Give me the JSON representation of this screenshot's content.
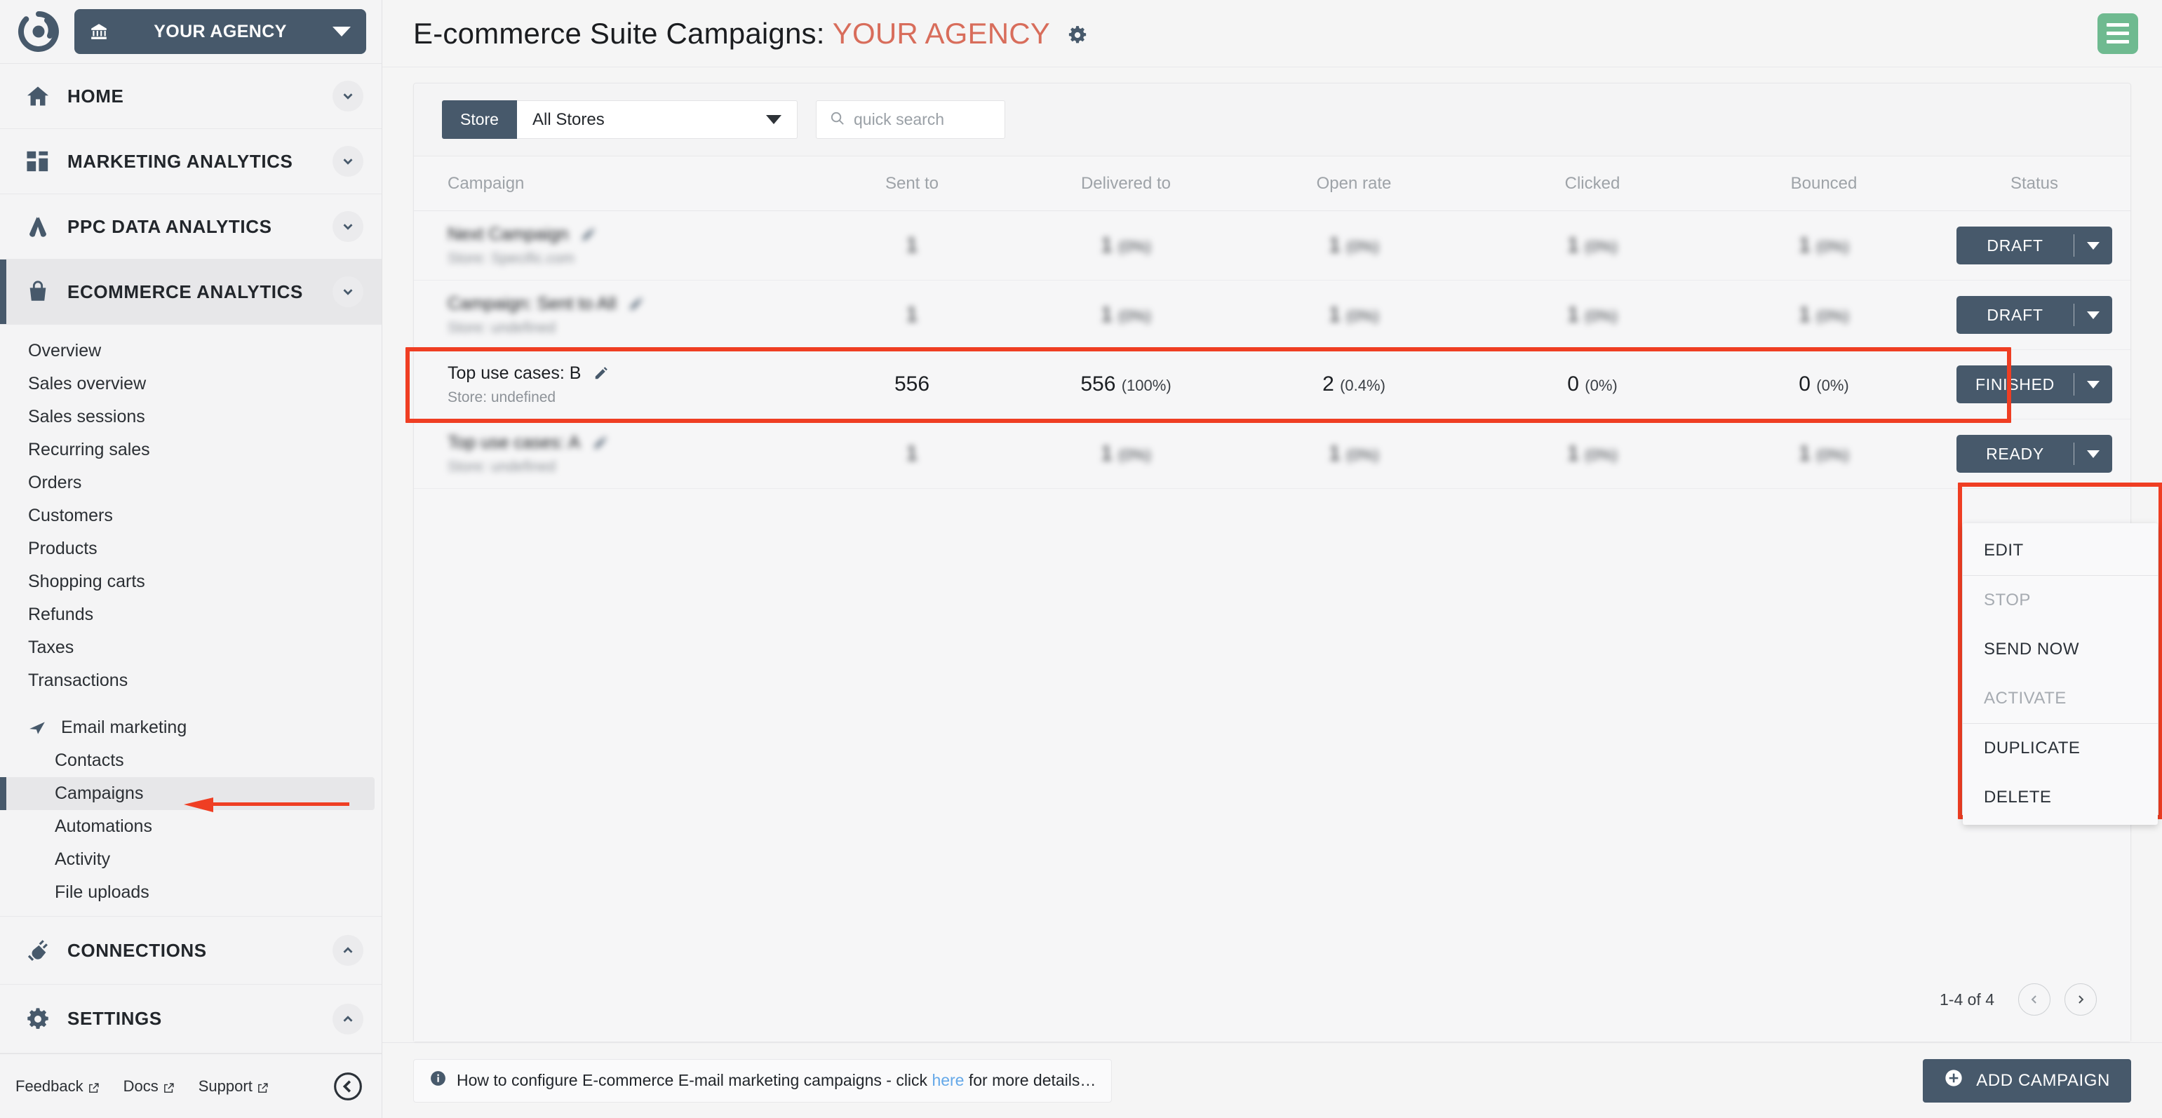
{
  "sidebar": {
    "agency_button": {
      "label": "YOUR AGENCY",
      "icon": "bank-icon"
    },
    "sections": [
      {
        "label": "HOME",
        "icon": "home-icon",
        "chevron": "chevron-down-icon",
        "active": false
      },
      {
        "label": "MARKETING ANALYTICS",
        "icon": "grid-icon",
        "chevron": "chevron-down-icon",
        "active": false
      },
      {
        "label": "PPC DATA ANALYTICS",
        "icon": "ads-icon",
        "chevron": "chevron-down-icon",
        "active": false
      },
      {
        "label": "ECOMMERCE ANALYTICS",
        "icon": "bag-icon",
        "chevron": "chevron-down-icon",
        "active": true
      }
    ],
    "links": [
      {
        "label": "Overview"
      },
      {
        "label": "Sales overview"
      },
      {
        "label": "Sales sessions"
      },
      {
        "label": "Recurring sales"
      },
      {
        "label": "Orders"
      },
      {
        "label": "Customers"
      },
      {
        "label": "Products"
      },
      {
        "label": "Shopping carts"
      },
      {
        "label": "Refunds"
      },
      {
        "label": "Taxes"
      },
      {
        "label": "Transactions"
      }
    ],
    "email_group": {
      "label": "Email marketing",
      "icon": "send-icon"
    },
    "email_links": [
      {
        "label": "Contacts",
        "selected": false
      },
      {
        "label": "Campaigns",
        "selected": true
      },
      {
        "label": "Automations",
        "selected": false
      },
      {
        "label": "Activity",
        "selected": false
      },
      {
        "label": "File uploads",
        "selected": false
      }
    ],
    "bottom_sections": [
      {
        "label": "CONNECTIONS",
        "icon": "plug-icon",
        "chevron": "chevron-up-icon"
      },
      {
        "label": "SETTINGS",
        "icon": "gear-icon",
        "chevron": "chevron-up-icon"
      }
    ],
    "footer_links": [
      {
        "label": "Feedback",
        "icon": "external-link-icon"
      },
      {
        "label": "Docs",
        "icon": "external-link-icon"
      },
      {
        "label": "Support",
        "icon": "external-link-icon"
      }
    ],
    "collapse_icon": "collapse-left-icon"
  },
  "header": {
    "title_main": "E-commerce Suite Campaigns:",
    "title_agency": "YOUR AGENCY",
    "gear_icon": "gear-icon",
    "menu_icon": "hamburger-icon",
    "accent_color": "#d86d5b",
    "menu_color": "#6fba90"
  },
  "filters": {
    "store_tag": "Store",
    "store_value": "All Stores",
    "store_caret": "chevron-down-icon",
    "search_icon": "search-icon",
    "search_value": "",
    "search_placeholder": "quick search"
  },
  "table": {
    "columns": [
      "Campaign",
      "Sent to",
      "Delivered to",
      "Open rate",
      "Clicked",
      "Bounced",
      "Status"
    ],
    "rows": [
      {
        "name": "",
        "store": "",
        "sent": "",
        "delivered": "",
        "delivered_pct": "",
        "open": "",
        "open_pct": "",
        "clicked": "",
        "clicked_pct": "",
        "bounced": "",
        "bounced_pct": "",
        "status": "DRAFT",
        "redacted": true,
        "highlighted": false
      },
      {
        "name": "",
        "store": "",
        "sent": "",
        "delivered": "",
        "delivered_pct": "",
        "open": "",
        "open_pct": "",
        "clicked": "",
        "clicked_pct": "",
        "bounced": "",
        "bounced_pct": "",
        "status": "DRAFT",
        "redacted": true,
        "highlighted": false
      },
      {
        "name": "Top use cases: B",
        "store": "Store: undefined",
        "sent": "556",
        "delivered": "556",
        "delivered_pct": "(100%)",
        "open": "2",
        "open_pct": "(0.4%)",
        "clicked": "0",
        "clicked_pct": "(0%)",
        "bounced": "0",
        "bounced_pct": "(0%)",
        "status": "FINISHED",
        "redacted": false,
        "highlighted": true
      },
      {
        "name": "",
        "store": "",
        "sent": "",
        "delivered": "",
        "delivered_pct": "",
        "open": "",
        "open_pct": "",
        "clicked": "",
        "clicked_pct": "",
        "bounced": "",
        "bounced_pct": "",
        "status": "READY",
        "redacted": true,
        "highlighted": false
      }
    ],
    "edit_icon": "pencil-icon",
    "status_caret": "chevron-down-icon"
  },
  "dropdown": {
    "items": [
      {
        "label": "EDIT",
        "disabled": false
      },
      {
        "label": "STOP",
        "disabled": true
      },
      {
        "label": "SEND NOW",
        "disabled": false
      },
      {
        "label": "ACTIVATE",
        "disabled": true
      },
      {
        "label": "DUPLICATE",
        "disabled": false
      },
      {
        "label": "DELETE",
        "disabled": false
      }
    ]
  },
  "pagination": {
    "range": "1-4 of 4",
    "prev_icon": "chevron-left-icon",
    "next_icon": "chevron-right-icon"
  },
  "footer": {
    "info_icon": "info-icon",
    "info_prefix": "How to configure E-commerce E-mail marketing campaigns - click ",
    "info_link": "here",
    "info_suffix": " for more details…",
    "add_icon": "plus-circle-icon",
    "add_label": "ADD CAMPAIGN"
  },
  "highlight_color": "#ef3e23"
}
